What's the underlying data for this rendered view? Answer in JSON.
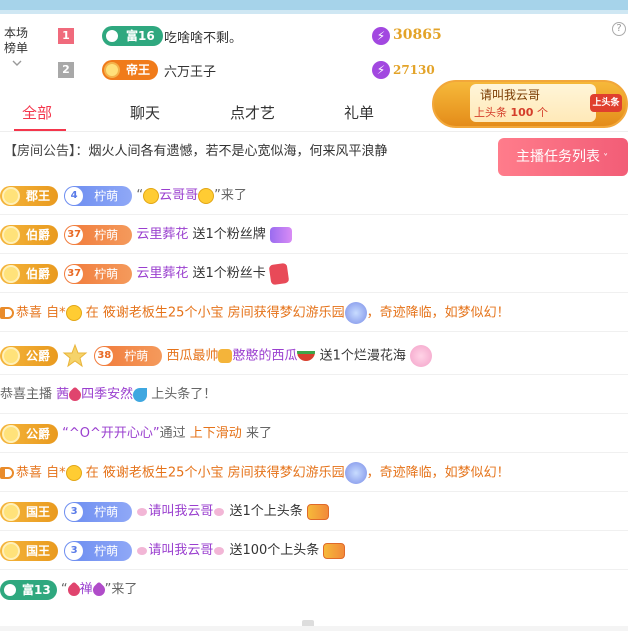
{
  "ranking": {
    "label": "本场榜单",
    "rows": [
      {
        "rank": "1",
        "badge": "富16",
        "name": "吃啥啥不剩。",
        "coins": "30865"
      },
      {
        "rank": "2",
        "badge": "帝王",
        "name": "六万王子",
        "coins": "27130"
      }
    ]
  },
  "tabs": [
    "全部",
    "聊天",
    "点才艺",
    "礼单"
  ],
  "promo": {
    "title": "请叫我云哥",
    "subtitle_prefix": "上头条",
    "count": "100",
    "subtitle_suffix": "个",
    "tag": "上头条"
  },
  "notice": {
    "label": "【房间公告】：",
    "text": "烟火人间各有遗憾，若不是心宽似海，何来风平浪静"
  },
  "task_button": "主播任务列表",
  "messages": [
    {
      "noble": "郡王",
      "level": "4",
      "fan": "柠萌",
      "text_a": "“",
      "name": "云哥哥",
      "text_b": "”来了"
    },
    {
      "noble": "伯爵",
      "level": "37",
      "fan": "柠萌",
      "name": "云里葬花",
      "text": "送1个粉丝牌"
    },
    {
      "noble": "伯爵",
      "level": "37",
      "fan": "柠萌",
      "name": "云里葬花",
      "text": "送1个粉丝卡"
    },
    {
      "prefix": "恭喜 自*",
      "mid": " 在 ",
      "place": "筱谢老板生25个小宝",
      "room": " 房间获得梦幻游乐园",
      "suffix": "，奇迹降临，如梦似幻！"
    },
    {
      "noble": "公爵",
      "level": "38",
      "fan": "柠萌",
      "name_a": "西瓜最帅",
      "name_b": "憨憨的西瓜",
      "text": " 送1个烂漫花海"
    },
    {
      "prefix": "恭喜主播 ",
      "name_a": "茜",
      "name_b": "四季安然",
      "suffix": " 上头条了！"
    },
    {
      "noble": "公爵",
      "text_a": "“^O^开开心心”",
      "text_b": "通过 ",
      "link": "上下滑动",
      "text_c": " 来了"
    },
    {
      "prefix": "恭喜 自*",
      "mid": " 在 ",
      "place": "筱谢老板生25个小宝",
      "room": " 房间获得梦幻游乐园",
      "suffix": "，奇迹降临，如梦似幻！"
    },
    {
      "noble": "国王",
      "level": "3",
      "fan": "柠萌",
      "name": "请叫我云哥",
      "text": " 送1个上头条"
    },
    {
      "noble": "国王",
      "level": "3",
      "fan": "柠萌",
      "name": "请叫我云哥",
      "text": " 送100个上头条"
    },
    {
      "badge": "富13",
      "text_a": "“",
      "name": "禅",
      "text_b": "”来了"
    }
  ],
  "colors": {
    "accent": "#f4364c",
    "coin": "#e3a328",
    "noble": "#f4b43a",
    "level_blue": "#6b8cf0",
    "level_orange": "#f17a3a",
    "rich_green": "#2fa87f"
  }
}
